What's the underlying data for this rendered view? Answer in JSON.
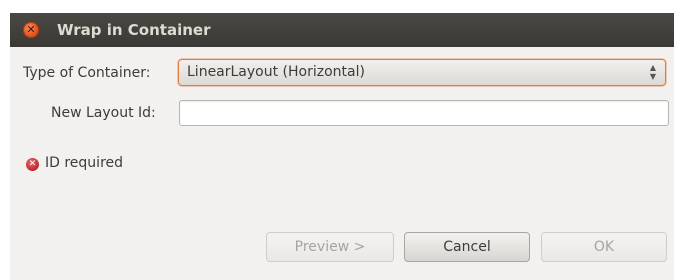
{
  "window": {
    "title": "Wrap in Container",
    "close_icon": "close-icon"
  },
  "form": {
    "container_type_label": "Type of Container:",
    "container_type_value": "LinearLayout (Horizontal)",
    "layout_id_label": "New Layout Id:",
    "layout_id_value": "",
    "layout_id_placeholder": ""
  },
  "status": {
    "error_icon": "error-icon",
    "error_message": "ID required"
  },
  "buttons": {
    "preview_label": "Preview >",
    "cancel_label": "Cancel",
    "ok_label": "OK"
  },
  "colors": {
    "titlebar": "#3c3b37",
    "close_button": "#df4a16",
    "focus_border": "#e8793e",
    "error": "#c0262a",
    "background": "#f2f1f0"
  }
}
